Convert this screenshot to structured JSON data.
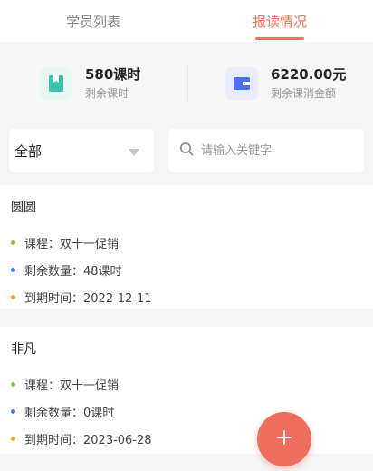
{
  "tabs": [
    {
      "label": "学员列表",
      "active": false
    },
    {
      "label": "报读情况",
      "active": true
    }
  ],
  "stats": {
    "remaining_hours_value": "580课时",
    "remaining_hours_label": "剩余课时",
    "remaining_amount_value": "6220.00元",
    "remaining_amount_label": "剩余课消金额"
  },
  "filter": {
    "selected": "全部",
    "search_placeholder": "请输入关键字"
  },
  "records": [
    {
      "name": "圆圆",
      "course": "课程：双十一促销",
      "remaining": "剩余数量：48课时",
      "expire": "到期时间：2022-12-11"
    },
    {
      "name": "非凡",
      "course": "课程：双十一促销",
      "remaining": "剩余数量：0课时",
      "expire": "到期时间：2023-06-28"
    }
  ],
  "colors": {
    "accent": "#f0705a",
    "fab": "#ee6e5e",
    "dot_course": "#8bc34a",
    "dot_remaining": "#4a7bf7",
    "dot_expire": "#f5a623"
  },
  "icons": {
    "stat_hours": "book-icon",
    "stat_amount": "wallet-icon",
    "select": "triangle-down-icon",
    "search": "search-icon",
    "fab": "plus-icon"
  }
}
